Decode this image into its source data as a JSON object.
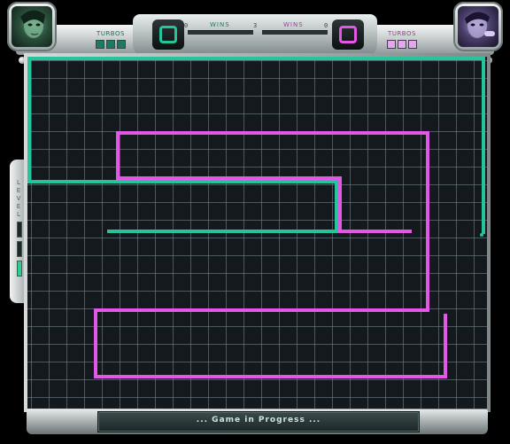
{
  "colors": {
    "player1": "#25c49a",
    "player2": "#e457e6",
    "grid_bg": "#13191c"
  },
  "player_left": {
    "turbos_label": "TURBOS",
    "turbo_cells": 3,
    "wins_label": "WINS",
    "wins_count": "0",
    "icon": "square-icon"
  },
  "player_right": {
    "turbos_label": "TURBOS",
    "turbo_cells": 3,
    "wins_label": "WINS",
    "wins_count": "0",
    "icon": "square-icon"
  },
  "center_digit": "3",
  "level": {
    "label": "LEVEL"
  },
  "status": "... Game in Progress ..."
}
